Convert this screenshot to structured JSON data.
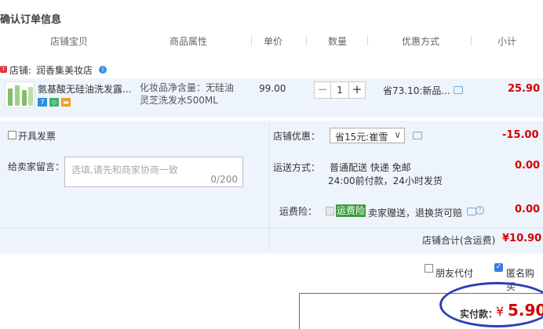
{
  "page_title": "确认订单信息",
  "columns": [
    "店铺宝贝",
    "商品属性",
    "单价",
    "数量",
    "优惠方式",
    "小计"
  ],
  "shop": {
    "label": "店铺:",
    "name": "润香集美妆店"
  },
  "item": {
    "title": "氨基酸无硅油洗发露...",
    "attr_line1": "化妆品净含量：无硅油",
    "attr_line2": "灵芝洗发水500ML",
    "unit_price": "99.00",
    "quantity": "1",
    "promo": "省73.10:新品...",
    "subtotal": "25.90",
    "tags": [
      "7",
      "◇",
      "▬"
    ]
  },
  "invoice": {
    "label": "开具发票"
  },
  "message": {
    "label": "给卖家留言：",
    "placeholder": "选填,请先和商家协商一致",
    "counter": "0/200"
  },
  "shop_discount": {
    "label": "店铺优惠：",
    "selected": "省15元:崔雪",
    "value": "-15.00"
  },
  "shipping": {
    "label": "运送方式：",
    "line1": "普通配送 快递 免邮",
    "line2": "24:00前付款，24小时发货",
    "value": "0.00"
  },
  "insurance": {
    "label": "运费险：",
    "tag": "运费险",
    "text": "卖家赠送，退换货可赔",
    "value": "0.00"
  },
  "shop_total": {
    "label": "店铺合计(含运费)",
    "value": "¥10.90"
  },
  "options": {
    "friend_pay": "朋友代付",
    "anonymous": "匿名购买"
  },
  "pay": {
    "label": "实付款：",
    "currency": "¥",
    "amount": "5.90"
  },
  "colors": {
    "accent_red": "#d40000",
    "panel_blue": "#eef4fb",
    "highlight_oval": "#2c3fb8"
  }
}
